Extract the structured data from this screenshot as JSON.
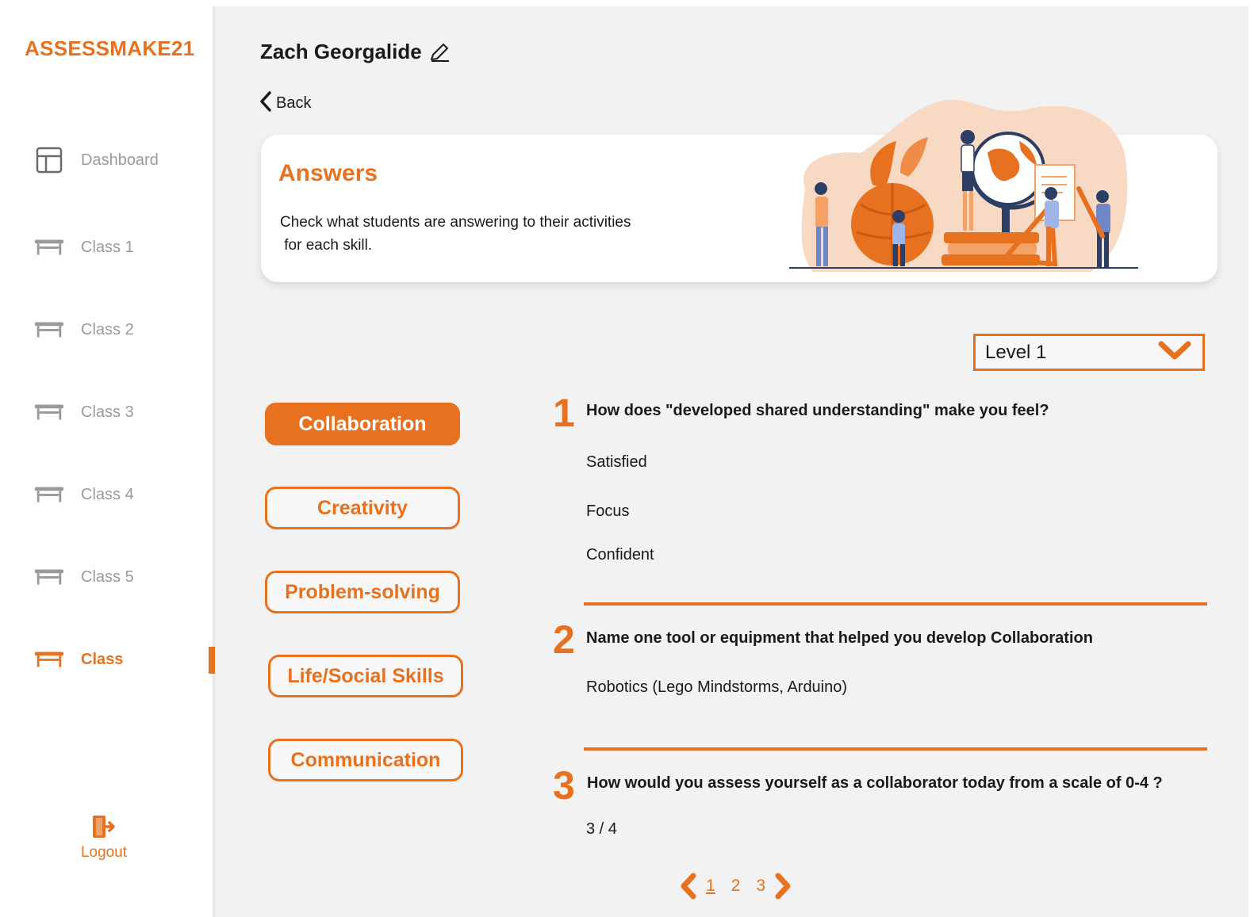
{
  "brand": {
    "logo_text": "ASSESSMAKE21",
    "accent_color": "#e8711f"
  },
  "sidebar": {
    "items": [
      {
        "label": "Dashboard",
        "icon": "dashboard-icon"
      },
      {
        "label": "Class 1",
        "icon": "desk-icon"
      },
      {
        "label": "Class 2",
        "icon": "desk-icon"
      },
      {
        "label": "Class 3",
        "icon": "desk-icon"
      },
      {
        "label": "Class 4",
        "icon": "desk-icon"
      },
      {
        "label": "Class 5",
        "icon": "desk-icon"
      },
      {
        "label": "Class",
        "icon": "desk-icon",
        "active": true
      }
    ],
    "logout_label": "Logout"
  },
  "header": {
    "user_name": "Zach Georgalide",
    "back_label": "Back"
  },
  "hero": {
    "title": "Answers",
    "description_line1": "Check what students are answering to their activities",
    "description_line2": " for each skill."
  },
  "level_select": {
    "value": "Level 1"
  },
  "skills": [
    {
      "label": "Collaboration",
      "active": true
    },
    {
      "label": "Creativity"
    },
    {
      "label": "Problem-solving"
    },
    {
      "label": "Life/Social Skills"
    },
    {
      "label": "Communication"
    }
  ],
  "questions": [
    {
      "number": "1",
      "text": "How does \"developed shared understanding\" make you feel?",
      "answers": [
        "Satisfied",
        "Focus",
        "Confident"
      ]
    },
    {
      "number": "2",
      "text": "Name one tool or equipment that helped you develop Collaboration",
      "answers": [
        "Robotics (Lego Mindstorms, Arduino)"
      ]
    },
    {
      "number": "3",
      "text": "How would you assess yourself as a collaborator today from a scale of 0-4 ?",
      "answers": [
        "3 / 4"
      ]
    }
  ],
  "pagination": {
    "pages": [
      "1",
      "2",
      "3"
    ],
    "current": "1"
  }
}
